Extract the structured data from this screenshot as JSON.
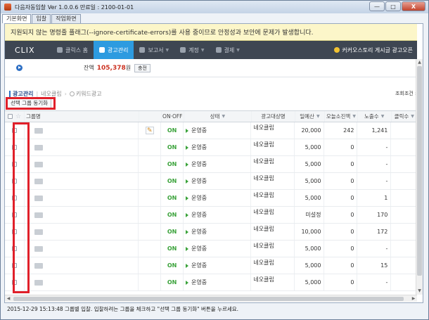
{
  "window": {
    "title": "다음자동입찰 Ver 1.0.0.6 만료일 : 2100-01-01",
    "minimize_label": "—",
    "maximize_label": "□",
    "close_label": "X"
  },
  "window_tabs": [
    "기본화면",
    "입찰",
    "작업화면"
  ],
  "warning": "지원되지 않는 명령줄 플래그(--ignore-certificate-errors)를 사용 중이므로 안정성과 보안에 문제가 발생합니다.",
  "nav": {
    "logo": "CLIX",
    "items": [
      {
        "label": "클릭스 홈",
        "icon": "home-icon",
        "active": false,
        "chevron": false
      },
      {
        "label": "광고관리",
        "icon": "gear-icon",
        "active": true,
        "chevron": false
      },
      {
        "label": "보고서",
        "icon": "chart-icon",
        "active": false,
        "chevron": true
      },
      {
        "label": "계정",
        "icon": "user-icon",
        "active": false,
        "chevron": true
      },
      {
        "label": "결제",
        "icon": "card-icon",
        "active": false,
        "chevron": true
      }
    ],
    "right_text": "커커오스토리 게시글 광고오픈"
  },
  "balance": {
    "label": "잔액",
    "value": "105,378",
    "unit": "원",
    "charge_label": "충전"
  },
  "breadcrumb": {
    "item1": "광고관리",
    "item2": "네오클립",
    "item3": "키워드광고"
  },
  "search_condition": "조회조건 : 오",
  "sync_button": "선택 그룹 동기화",
  "table": {
    "headers": {
      "name": "그룹명",
      "onoff": "ON·OFF",
      "state": "상태",
      "target": "광고대상명",
      "budget": "일예산",
      "spend": "오늘소진액",
      "impressions": "노출수",
      "clicks": "클릭수"
    },
    "rows": [
      {
        "onoff": "ON",
        "state": "운영중",
        "target": "네오클립",
        "budget": "20,000",
        "spend": "242",
        "impressions": "1,241",
        "clicks": ""
      },
      {
        "onoff": "ON",
        "state": "운영중",
        "target": "네오클립",
        "budget": "5,000",
        "spend": "0",
        "impressions": "-",
        "clicks": ""
      },
      {
        "onoff": "ON",
        "state": "운영중",
        "target": "네오클립",
        "budget": "5,000",
        "spend": "0",
        "impressions": "-",
        "clicks": ""
      },
      {
        "onoff": "ON",
        "state": "운영중",
        "target": "네오클립",
        "budget": "5,000",
        "spend": "0",
        "impressions": "-",
        "clicks": ""
      },
      {
        "onoff": "ON",
        "state": "운영중",
        "target": "네오클립",
        "budget": "5,000",
        "spend": "0",
        "impressions": "1",
        "clicks": ""
      },
      {
        "onoff": "ON",
        "state": "운영중",
        "target": "네오클립",
        "budget": "미설정",
        "spend": "0",
        "impressions": "170",
        "clicks": ""
      },
      {
        "onoff": "ON",
        "state": "운영중",
        "target": "네오클립",
        "budget": "10,000",
        "spend": "0",
        "impressions": "172",
        "clicks": ""
      },
      {
        "onoff": "ON",
        "state": "운영중",
        "target": "네오클립",
        "budget": "5,000",
        "spend": "0",
        "impressions": "-",
        "clicks": ""
      },
      {
        "onoff": "ON",
        "state": "운영중",
        "target": "네오클립",
        "budget": "5,000",
        "spend": "0",
        "impressions": "15",
        "clicks": ""
      },
      {
        "onoff": "ON",
        "state": "운영중",
        "target": "네오클립",
        "budget": "5,000",
        "spend": "0",
        "impressions": "-",
        "clicks": ""
      }
    ]
  },
  "status_bar": "2015-12-29 15:13:48 그룹별 입찰. 입찰하려는 그룹을 체크하고 \"선택 그룹 동기화\" 버튼을 누르세요.",
  "colors": {
    "nav_bg": "#3e4652",
    "nav_active": "#2d9be0",
    "on_green": "#3aa23a",
    "balance_red": "#cc3322",
    "annotation_red": "#e0202a"
  }
}
